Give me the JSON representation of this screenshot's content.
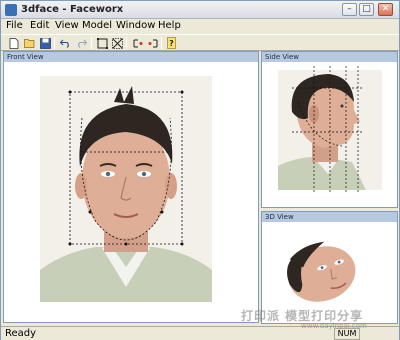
{
  "window": {
    "title": "3dface - Faceworx"
  },
  "menu": [
    "File",
    "Edit",
    "View",
    "Model",
    "Window",
    "Help"
  ],
  "toolbar": {
    "buttons": [
      "new-icon",
      "open-icon",
      "save-icon",
      "undo-icon",
      "redo-icon",
      "select-rect-icon",
      "transform-icon",
      "mirror-left-icon",
      "mirror-right-icon",
      "help-icon"
    ]
  },
  "panels": {
    "front": "Front View",
    "side": "Side View",
    "view3d": "3D View"
  },
  "status": {
    "text": "Ready",
    "num": "NUM"
  },
  "watermark": {
    "text": "打印派 模型打印分享",
    "url": "www.dayinpai.com"
  }
}
